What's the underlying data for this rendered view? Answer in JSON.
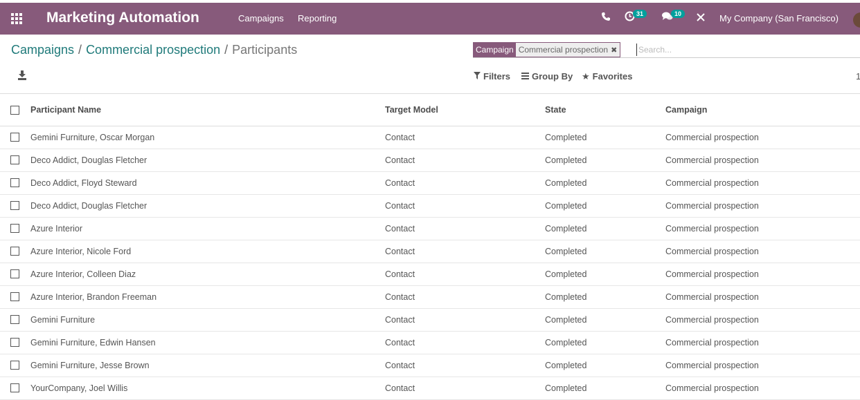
{
  "navbar": {
    "app_title": "Marketing Automation",
    "menu": [
      "Campaigns",
      "Reporting"
    ],
    "activity_count": "31",
    "message_count": "10",
    "company": "My Company (San Francisco)",
    "accent_color": "#875a7b"
  },
  "breadcrumb": {
    "items": [
      "Campaigns",
      "Commercial prospection"
    ],
    "current": "Participants",
    "separator": "/"
  },
  "search": {
    "facet_label": "Campaign",
    "facet_value": "Commercial prospection",
    "placeholder": "Search..."
  },
  "toolbar": {
    "filters_label": "Filters",
    "group_by_label": "Group By",
    "favorites_label": "Favorites",
    "pager_text": "1"
  },
  "table": {
    "columns": [
      "Participant Name",
      "Target Model",
      "State",
      "Campaign"
    ],
    "rows": [
      [
        "Gemini Furniture, Oscar Morgan",
        "Contact",
        "Completed",
        "Commercial prospection"
      ],
      [
        "Deco Addict, Douglas Fletcher",
        "Contact",
        "Completed",
        "Commercial prospection"
      ],
      [
        "Deco Addict, Floyd Steward",
        "Contact",
        "Completed",
        "Commercial prospection"
      ],
      [
        "Deco Addict, Douglas Fletcher",
        "Contact",
        "Completed",
        "Commercial prospection"
      ],
      [
        "Azure Interior",
        "Contact",
        "Completed",
        "Commercial prospection"
      ],
      [
        "Azure Interior, Nicole Ford",
        "Contact",
        "Completed",
        "Commercial prospection"
      ],
      [
        "Azure Interior, Colleen Diaz",
        "Contact",
        "Completed",
        "Commercial prospection"
      ],
      [
        "Azure Interior, Brandon Freeman",
        "Contact",
        "Completed",
        "Commercial prospection"
      ],
      [
        "Gemini Furniture",
        "Contact",
        "Completed",
        "Commercial prospection"
      ],
      [
        "Gemini Furniture, Edwin Hansen",
        "Contact",
        "Completed",
        "Commercial prospection"
      ],
      [
        "Gemini Furniture, Jesse Brown",
        "Contact",
        "Completed",
        "Commercial prospection"
      ],
      [
        "YourCompany, Joel Willis",
        "Contact",
        "Completed",
        "Commercial prospection"
      ]
    ]
  }
}
